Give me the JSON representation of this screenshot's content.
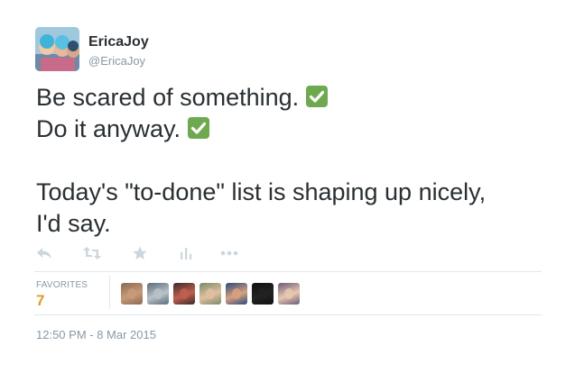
{
  "user": {
    "display_name": "EricaJoy",
    "handle": "@EricaJoy",
    "avatar_icon": "profile-photo"
  },
  "tweet": {
    "lines": [
      "Be scared of something.",
      "Do it anyway.",
      "",
      "Today's \"to-done\" list is shaping up nicely,",
      "I'd say."
    ],
    "emoji": "white-heavy-check-mark",
    "emoji_color": "#6ea94f"
  },
  "actions": [
    {
      "name": "reply",
      "icon": "reply-icon"
    },
    {
      "name": "retweet",
      "icon": "retweet-icon"
    },
    {
      "name": "favorite",
      "icon": "star-icon"
    },
    {
      "name": "stats",
      "icon": "bar-chart-icon"
    },
    {
      "name": "more",
      "icon": "more-dots-icon"
    }
  ],
  "favorites": {
    "label": "FAVORITES",
    "count": "7",
    "count_color": "#e09a2a",
    "avatars": [
      {
        "name": "favoriter-1",
        "colors": [
          "#8a6a52",
          "#c89a78"
        ]
      },
      {
        "name": "favoriter-2",
        "colors": [
          "#5a6b7a",
          "#b9c2c8"
        ]
      },
      {
        "name": "favoriter-3",
        "colors": [
          "#3a2a2a",
          "#c06050"
        ]
      },
      {
        "name": "favoriter-4",
        "colors": [
          "#7a8a6a",
          "#e0c0a0"
        ]
      },
      {
        "name": "favoriter-5",
        "colors": [
          "#2a4a7a",
          "#d8a080"
        ]
      },
      {
        "name": "favoriter-6",
        "colors": [
          "#111111",
          "#222222"
        ]
      },
      {
        "name": "favoriter-7",
        "colors": [
          "#6a5a7a",
          "#e8c8b0"
        ]
      }
    ]
  },
  "timestamp": "12:50 PM - 8 Mar 2015",
  "colors": {
    "text": "#292f33",
    "muted": "#8899a6",
    "icon": "#ccd6dd",
    "divider": "#e1e8ed"
  }
}
